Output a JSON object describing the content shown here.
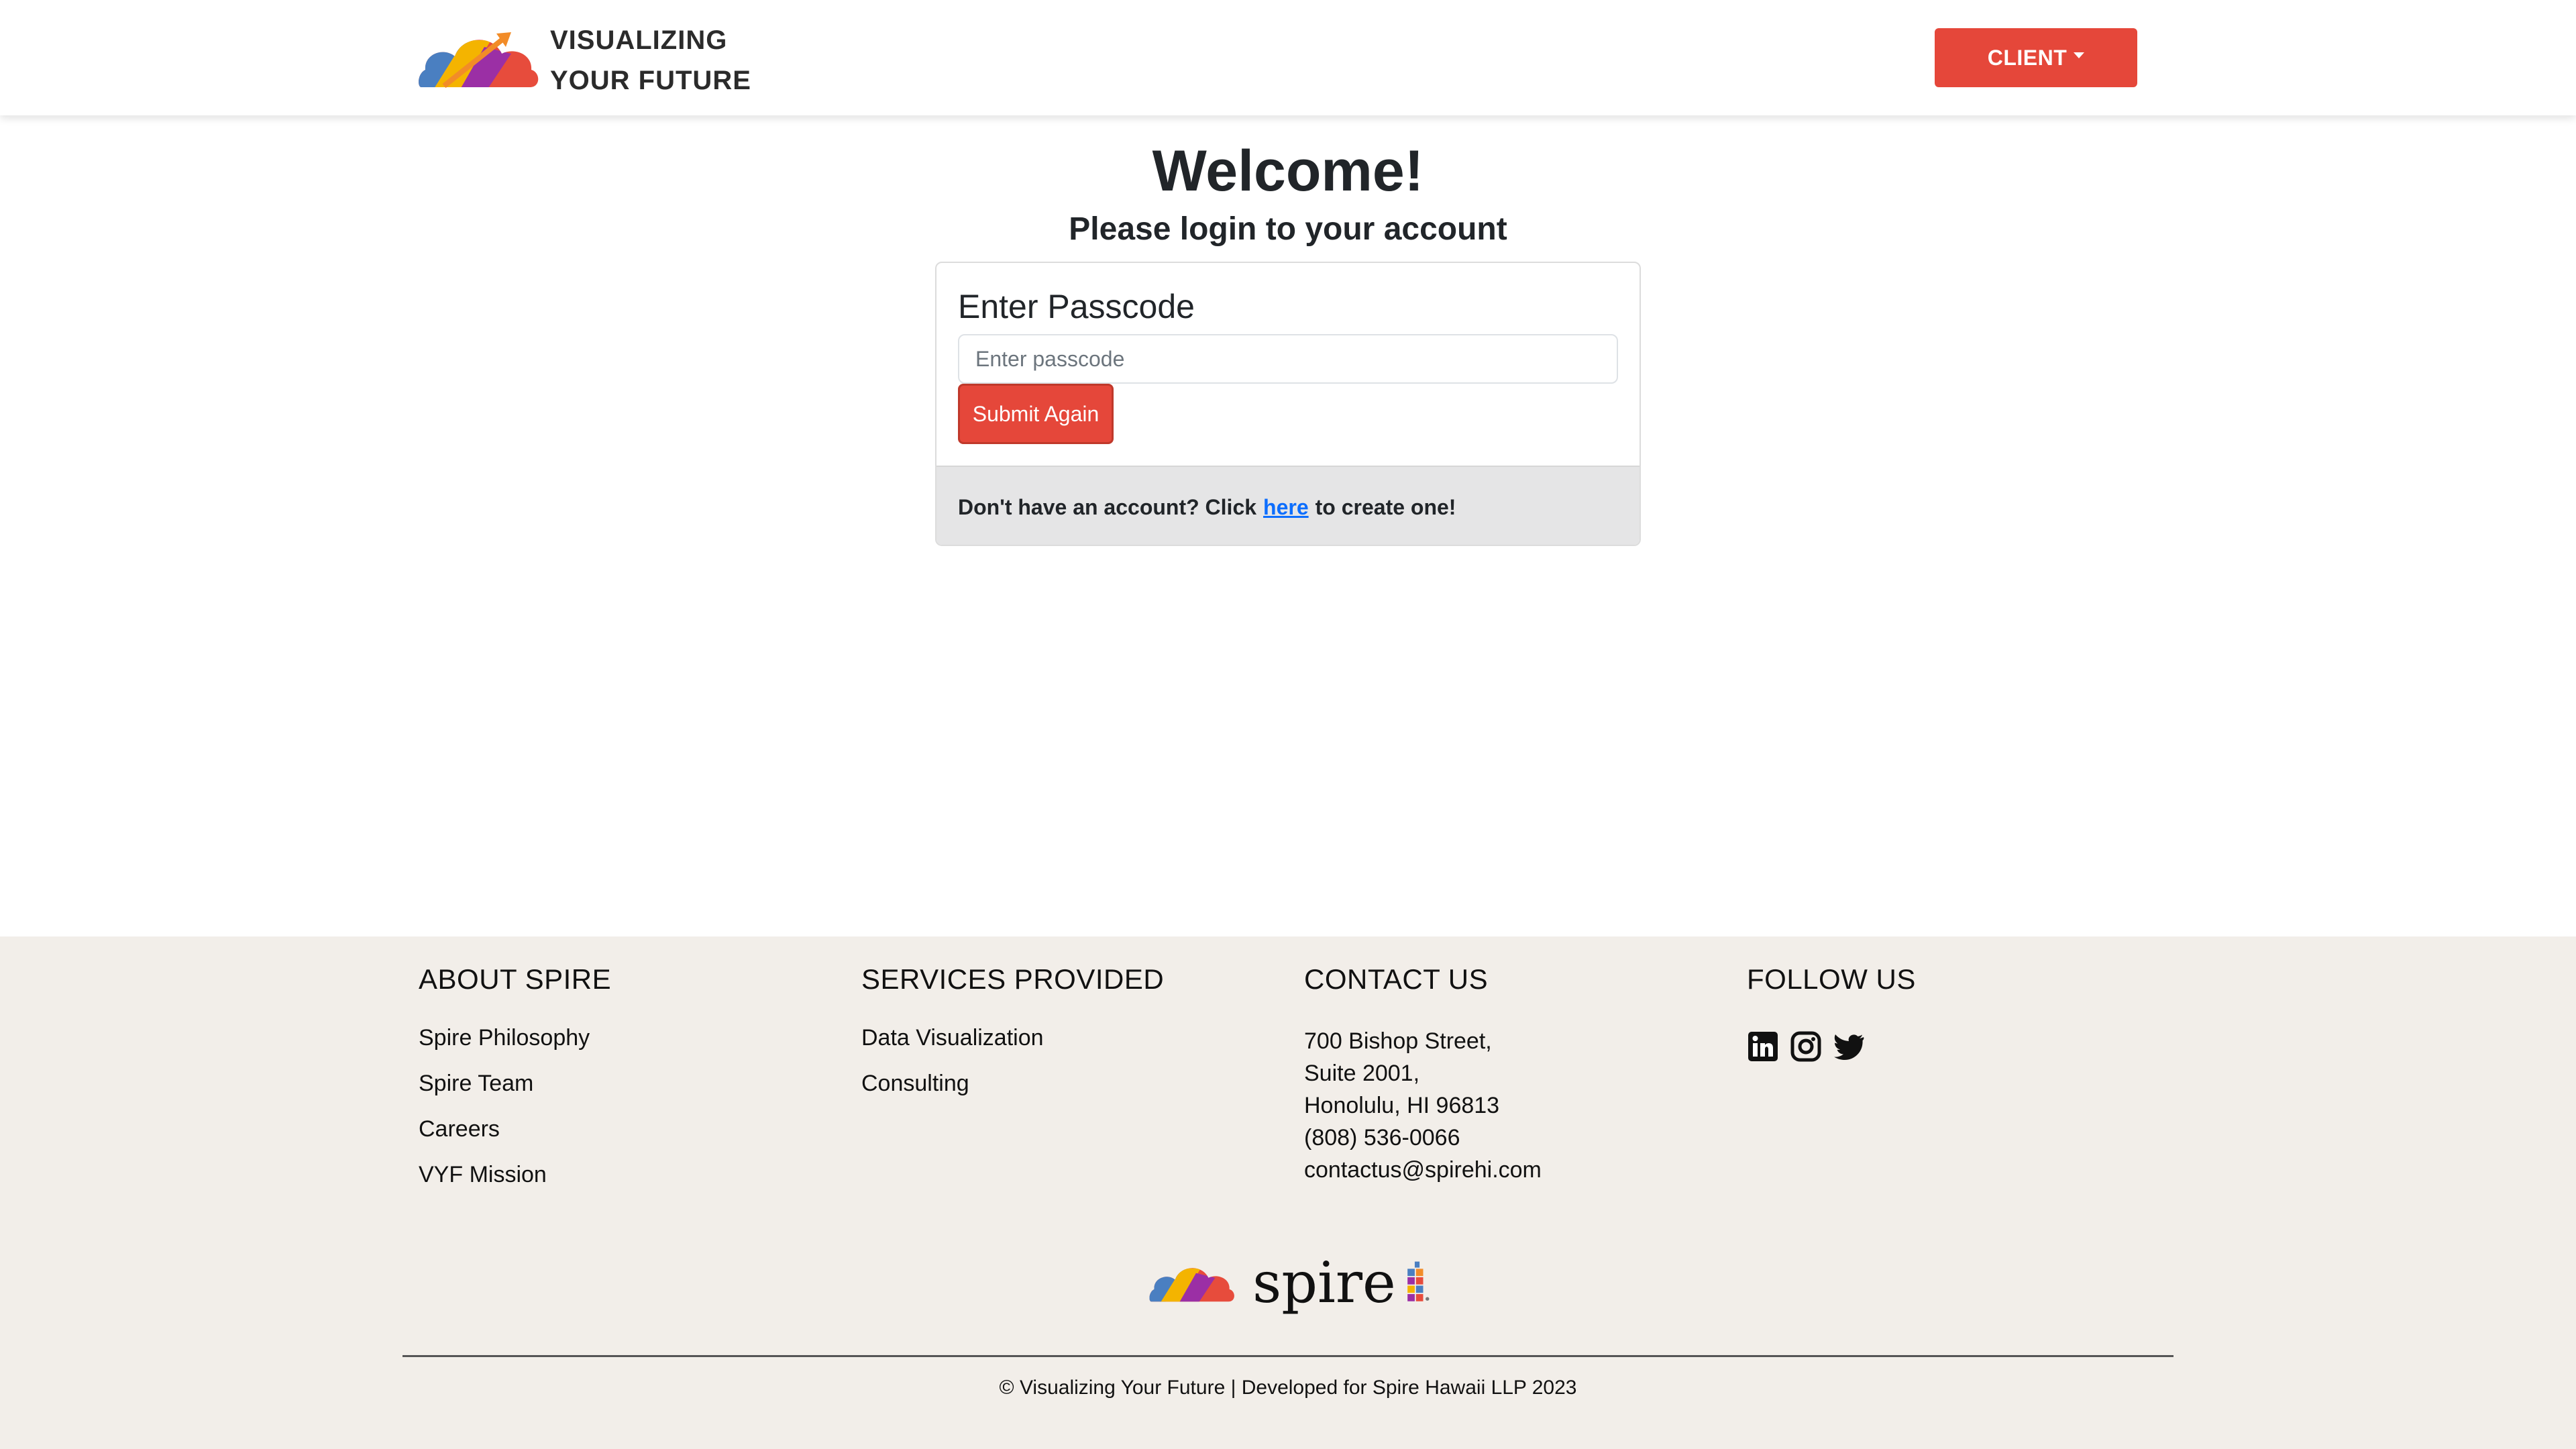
{
  "header": {
    "brand_line1": "VISUALIZING",
    "brand_line2": "YOUR FUTURE",
    "client_button": "CLIENT"
  },
  "main": {
    "welcome": "Welcome!",
    "subtitle": "Please login to your account",
    "card_title": "Enter Passcode",
    "passcode_placeholder": "Enter passcode",
    "submit_button": "Submit Again",
    "signup_prefix": "Don't have an account? Click",
    "signup_link": "here",
    "signup_suffix": "to create one!"
  },
  "footer": {
    "about": {
      "heading": "ABOUT SPIRE",
      "links": [
        "Spire Philosophy",
        "Spire Team",
        "Careers",
        "VYF Mission"
      ]
    },
    "services": {
      "heading": "SERVICES PROVIDED",
      "links": [
        "Data Visualization",
        "Consulting"
      ]
    },
    "contact": {
      "heading": "CONTACT US",
      "lines": [
        "700 Bishop Street,",
        "Suite 2001,",
        "Honolulu, HI 96813",
        "(808) 536-0066",
        "contactus@spirehi.com"
      ]
    },
    "follow": {
      "heading": "FOLLOW US",
      "icons": [
        "linkedin-icon",
        "instagram-icon",
        "twitter-icon"
      ]
    },
    "logo_wordmark": "spire",
    "copyright": "© Visualizing Your Future | Developed for Spire Hawaii LLP 2023"
  },
  "colors": {
    "accent": "#e5473a",
    "footer_bg": "#f2eee9",
    "link": "#0d6efd"
  }
}
